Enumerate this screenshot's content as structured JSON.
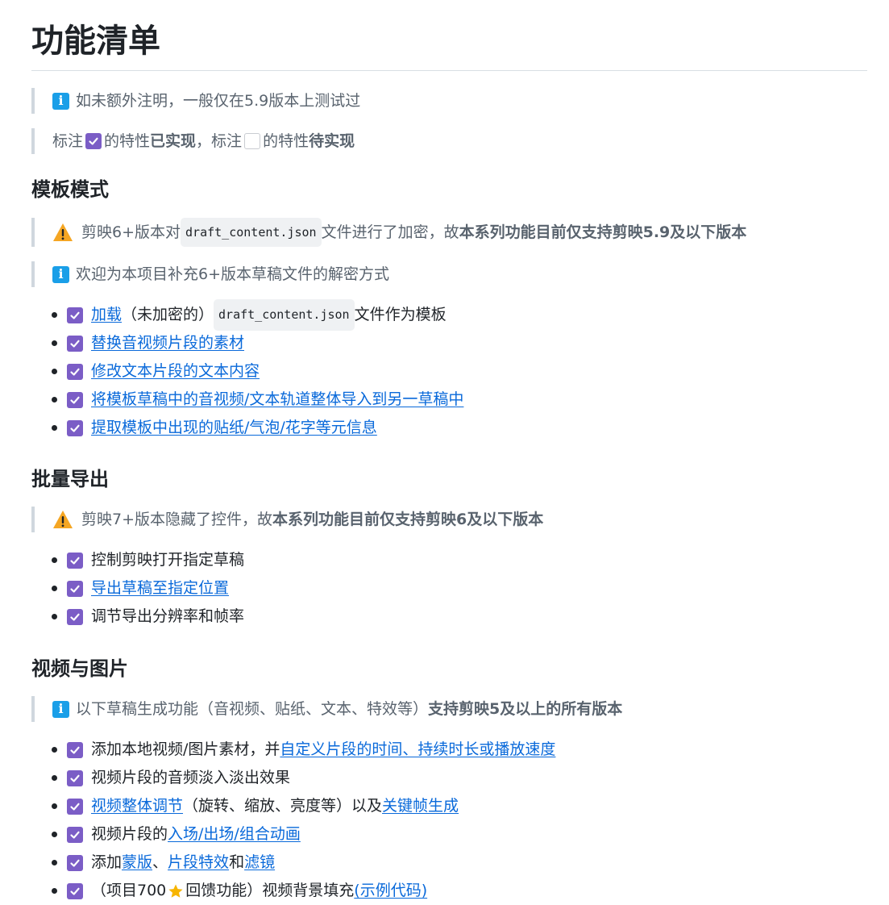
{
  "title": "功能清单",
  "notes": {
    "tested": "如未额外注明，一般仅在5.9版本上测试过",
    "legend": {
      "t1": "标注",
      "t2": "的特性",
      "b1": "已实现",
      "t3": "，标注",
      "t4": "的特性",
      "b2": "待实现"
    }
  },
  "template_mode": {
    "heading": "模板模式",
    "warn": {
      "t1": "剪映6+版本对",
      "code": "draft_content.json",
      "t2": "文件进行了加密，故",
      "bold": "本系列功能目前仅支持剪映5.9及以下版本"
    },
    "info": "欢迎为本项目补充6+版本草稿文件的解密方式",
    "items": [
      {
        "link": "加载",
        "t1": "（未加密的）",
        "code": "draft_content.json",
        "t2": "文件作为模板"
      },
      {
        "link": "替换音视频片段的素材"
      },
      {
        "link": "修改文本片段的文本内容"
      },
      {
        "link": "将模板草稿中的音视频/文本轨道整体导入到另一草稿中"
      },
      {
        "link": "提取模板中出现的贴纸/气泡/花字等元信息"
      }
    ]
  },
  "batch_export": {
    "heading": "批量导出",
    "warn": {
      "t1": "剪映7+版本隐藏了控件，故",
      "bold": "本系列功能目前仅支持剪映6及以下版本"
    },
    "items": [
      {
        "text": "控制剪映打开指定草稿"
      },
      {
        "link": "导出草稿至指定位置"
      },
      {
        "text": "调节导出分辨率和帧率"
      }
    ]
  },
  "video_image": {
    "heading": "视频与图片",
    "info": {
      "t1": "以下草稿生成功能（音视频、贴纸、文本、特效等）",
      "bold": "支持剪映5及以上的所有版本"
    },
    "items": {
      "i1": {
        "t1": "添加本地视频/图片素材，并",
        "link": "自定义片段的时间、持续时长或播放速度"
      },
      "i2": {
        "text": "视频片段的音频淡入淡出效果"
      },
      "i3": {
        "link1": "视频整体调节",
        "t1": "（旋转、缩放、亮度等）以及",
        "link2": "关键帧生成"
      },
      "i4": {
        "t1": "视频片段的",
        "link": "入场/出场/组合动画"
      },
      "i5": {
        "t1": "添加",
        "link1": "蒙版",
        "t2": "、",
        "link2": "片段特效",
        "t3": "和",
        "link3": "滤镜"
      },
      "i6": {
        "t1": "（项目700",
        "t2": "回馈功能）视频背景填充",
        "link": "(示例代码)"
      }
    }
  },
  "colors": {
    "checkbox": "#7b5dc6",
    "link": "#0969da",
    "info": "#1a9fe8",
    "warn": "#f5a623"
  },
  "icons": [
    "info-icon",
    "warning-icon",
    "checkbox-checked-icon",
    "checkbox-empty-icon",
    "star-icon"
  ]
}
